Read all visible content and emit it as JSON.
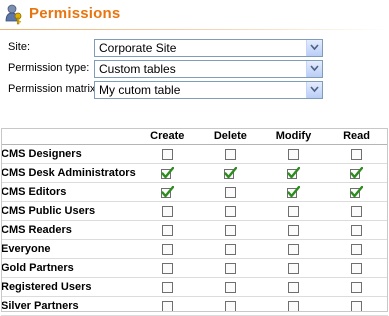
{
  "header": {
    "title": "Permissions",
    "icon": "users-key-icon"
  },
  "form": {
    "site": {
      "label": "Site:",
      "value": "Corporate Site"
    },
    "permission_type": {
      "label": "Permission type:",
      "value": "Custom tables"
    },
    "permission_matrix": {
      "label": "Permission matrix:",
      "value": "My cutom table"
    }
  },
  "matrix": {
    "columns": [
      "Create",
      "Delete",
      "Modify",
      "Read"
    ],
    "rows": [
      {
        "role": "CMS Designers",
        "checks": [
          false,
          false,
          false,
          false
        ]
      },
      {
        "role": "CMS Desk Administrators",
        "checks": [
          true,
          true,
          true,
          true
        ]
      },
      {
        "role": "CMS Editors",
        "checks": [
          true,
          false,
          true,
          true
        ]
      },
      {
        "role": "CMS Public Users",
        "checks": [
          false,
          false,
          false,
          false
        ]
      },
      {
        "role": "CMS Readers",
        "checks": [
          false,
          false,
          false,
          false
        ]
      },
      {
        "role": "Everyone",
        "checks": [
          false,
          false,
          false,
          false
        ]
      },
      {
        "role": "Gold Partners",
        "checks": [
          false,
          false,
          false,
          false
        ]
      },
      {
        "role": "Registered Users",
        "checks": [
          false,
          false,
          false,
          false
        ]
      },
      {
        "role": "Silver Partners",
        "checks": [
          false,
          false,
          false,
          false
        ]
      }
    ]
  },
  "colors": {
    "title": "#e8750f",
    "check": "#2e8b1f",
    "select_border": "#7f9db9"
  }
}
